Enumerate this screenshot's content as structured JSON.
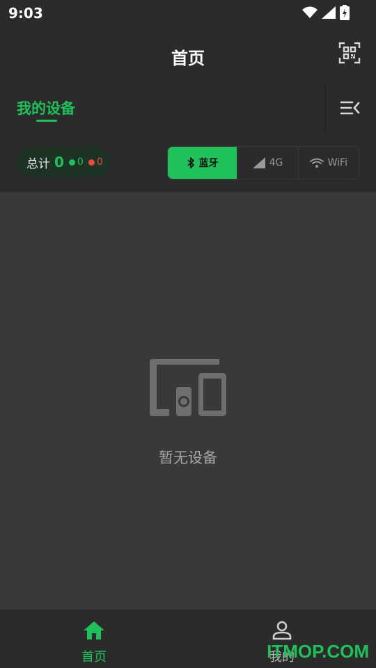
{
  "status_bar": {
    "time": "9:03"
  },
  "app_bar": {
    "title": "首页"
  },
  "tabs": {
    "mine_label": "我的设备"
  },
  "filter": {
    "total_label": "总计",
    "total_count": "0",
    "online_count": "0",
    "offline_count": "0",
    "segments": [
      {
        "label": "蓝牙",
        "icon": "bluetooth-icon",
        "active": true
      },
      {
        "label": "4G",
        "icon": "signal-icon",
        "active": false
      },
      {
        "label": "WiFi",
        "icon": "wifi-icon",
        "active": false
      }
    ]
  },
  "empty": {
    "text": "暂无设备",
    "icon": "devices-icon"
  },
  "bottom_nav": {
    "items": [
      {
        "label": "首页",
        "icon": "home-icon",
        "active": true
      },
      {
        "label": "我的",
        "icon": "person-icon",
        "active": false
      }
    ]
  },
  "watermark": "ITMOP.COM",
  "colors": {
    "accent": "#1fc15a",
    "offline": "#e94a3b",
    "background": "#2b2b2b",
    "content": "#393939"
  }
}
